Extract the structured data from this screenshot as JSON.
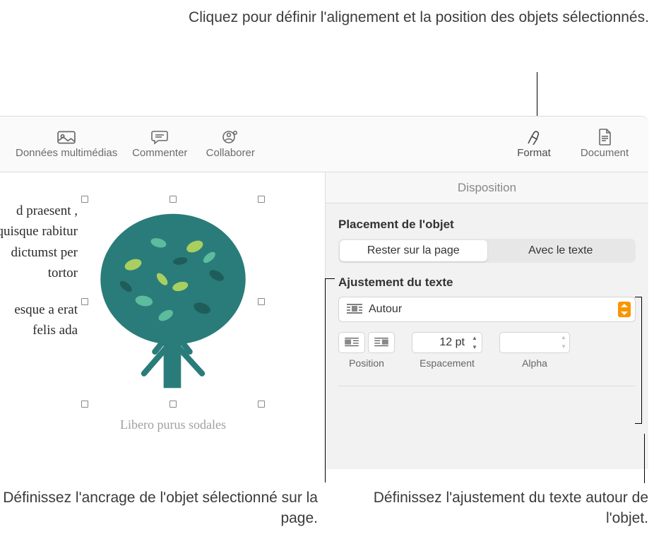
{
  "callouts": {
    "top": "Cliquez pour définir l'alignement et la position des objets sélectionnés.",
    "bottom_left": "Définissez l'ancrage de l'objet sélectionné sur la page.",
    "bottom_right": "Définissez l'ajustement du texte autour de l'objet."
  },
  "toolbar": {
    "media": "Données multimédias",
    "comment": "Commenter",
    "collaborate": "Collaborer",
    "format": "Format",
    "document": "Document"
  },
  "doc": {
    "para1": "d praesent , quisque rabitur dictumst per tortor",
    "para2": "esque a erat felis ada",
    "caption": "Libero purus sodales"
  },
  "sidebar": {
    "tab": "Disposition",
    "placement_label": "Placement de l'objet",
    "seg_stay": "Rester sur la page",
    "seg_inline": "Avec le texte",
    "wrap_label": "Ajustement du texte",
    "wrap_value": "Autour",
    "position_label": "Position",
    "spacing_label": "Espacement",
    "spacing_value": "12 pt",
    "alpha_label": "Alpha"
  }
}
